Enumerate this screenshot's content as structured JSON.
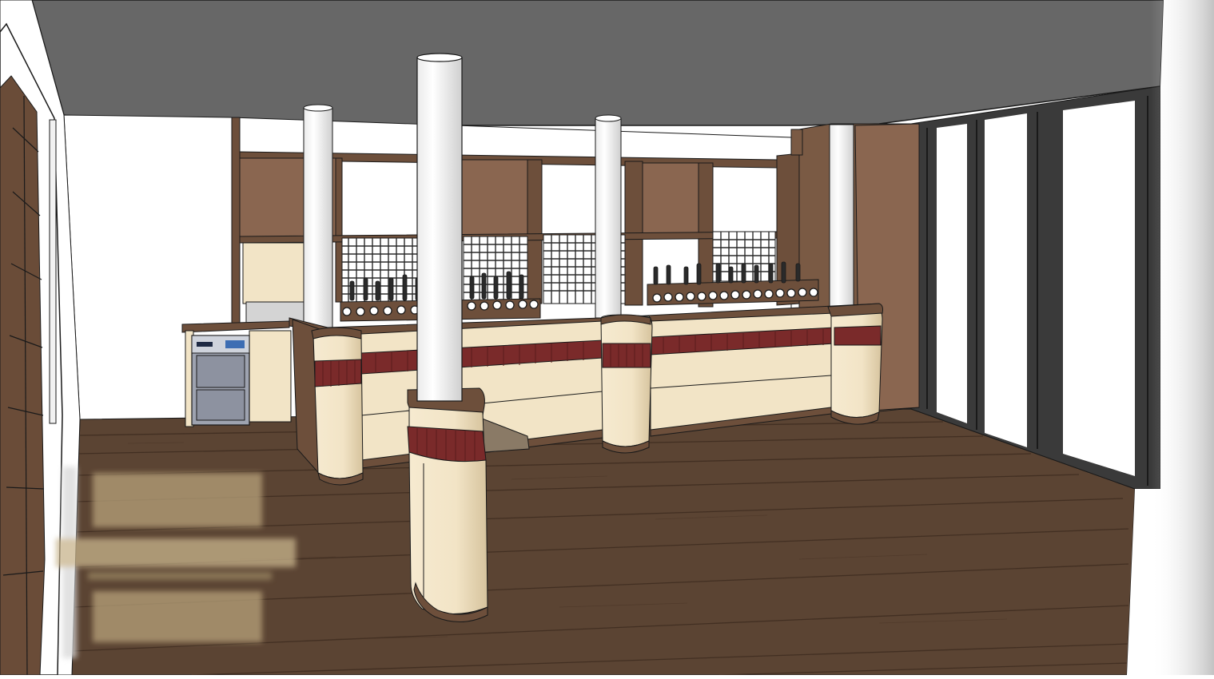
{
  "scene": {
    "kind": "3d-model-render",
    "subject": "bar interior",
    "colors": {
      "ceiling": "#676767",
      "wall": "#ffffff",
      "floor": "#5b4433",
      "floor_line": "#3e2c20",
      "wood": "#7a5a44",
      "wood_dark": "#5b3e2c",
      "cream": "#f2e4c6",
      "cream_shade": "#d9c9a6",
      "accent_red": "#7a2a2a",
      "column": "#ffffff",
      "glass": "#ffffff",
      "frame": "#3a3a3a",
      "outline": "#1a1a1a"
    }
  },
  "watermark": {
    "present": true,
    "blurred": true,
    "text": ""
  }
}
